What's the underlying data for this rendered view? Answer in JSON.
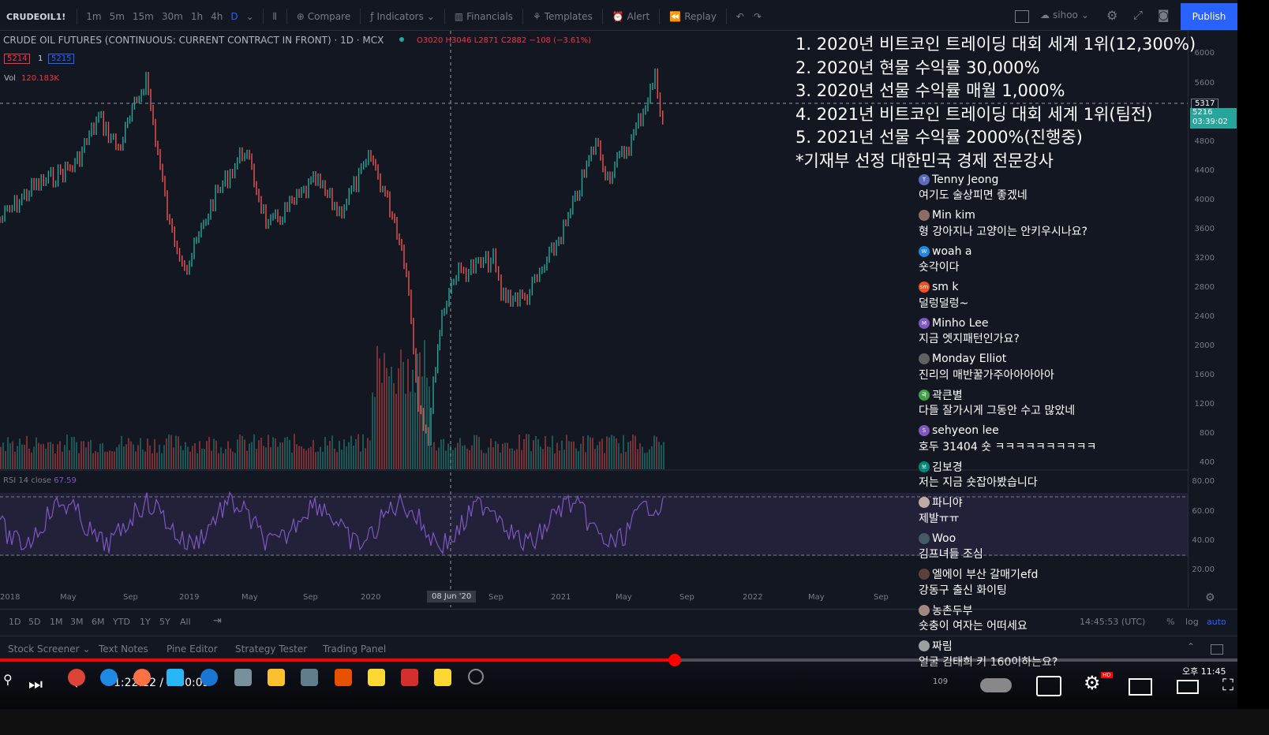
{
  "toolbar": {
    "symbol": "CRUDEOIL1!",
    "timeframes": [
      "1m",
      "5m",
      "15m",
      "30m",
      "1h",
      "4h",
      "D"
    ],
    "active_timeframe": "D",
    "compare": "Compare",
    "indicators": "Indicators",
    "financials": "Financials",
    "templates": "Templates",
    "alert": "Alert",
    "replay": "Replay",
    "user": "sihoo",
    "publish": "Publish"
  },
  "legend": {
    "title": "CRUDE OIL FUTURES (CONTINUOUS: CURRENT CONTRACT IN FRONT) · 1D · MCX",
    "ohlc": "O3020 H3046 L2871 C2882 −108 (−3.61%)",
    "bid": "5214",
    "spread": "1",
    "ask": "5215",
    "vol_label": "Vol",
    "vol_value": "120.183K",
    "rsi_label": "RSI 14 close",
    "rsi_value": "67.59"
  },
  "price_axis": {
    "ticks": [
      "6000",
      "5600",
      "4800",
      "4400",
      "4000",
      "3600",
      "3200",
      "2800",
      "2400",
      "2000",
      "1600",
      "1200",
      "800",
      "400"
    ],
    "rsi_ticks": [
      "80.00",
      "60.00",
      "40.00",
      "20.00"
    ],
    "last_price": "5317",
    "last_price2": "5216",
    "countdown": "03:39:02"
  },
  "time_axis": {
    "ticks": [
      "2018",
      "May",
      "Sep",
      "2019",
      "May",
      "Sep",
      "2020",
      "Sep",
      "2021",
      "May",
      "Sep",
      "2022",
      "May",
      "Sep"
    ],
    "crosshair_label": "08 Jun '20"
  },
  "bottom_bar": {
    "ranges": [
      "1D",
      "5D",
      "1M",
      "3M",
      "6M",
      "YTD",
      "1Y",
      "5Y",
      "All"
    ],
    "clock": "14:45:53 (UTC)",
    "percent": "%",
    "log": "log",
    "auto": "auto"
  },
  "panel_tabs": [
    "Stock Screener",
    "Text Notes",
    "Pine Editor",
    "Strategy Tester",
    "Trading Panel"
  ],
  "overlay_lines": [
    "1. 2020년 비트코인 트레이딩 대회 세계 1위(12,300%)",
    "2. 2020년 현물 수익률 30,000%",
    "3. 2020년 선물 수익률 매월 1,000%",
    "4. 2021년 비트코인 트레이딩 대회 세계 1위(팀전)",
    "5. 2021년 선물 수익률 2000%(진행중)",
    "*기재부 선정 대한민국 경제 전문강사"
  ],
  "chat": [
    {
      "author": "Tenny Jeong",
      "text": "여기도 술상피면 좋겠네",
      "avatar": "#5c6bc0",
      "initial": "T"
    },
    {
      "author": "Min kim",
      "text": "형 강아지나 고양이는 안키우시나요?",
      "avatar": "#8d6e63",
      "initial": ""
    },
    {
      "author": "woah a",
      "text": "숏각이다",
      "avatar": "#1e88e5",
      "initial": "W"
    },
    {
      "author": "sm k",
      "text": "덜렁덜렁~",
      "avatar": "#f4511e",
      "initial": "sm"
    },
    {
      "author": "Minho Lee",
      "text": "지금 엣지패턴인가요?",
      "avatar": "#7e57c2",
      "initial": "M"
    },
    {
      "author": "Monday Elliot",
      "text": "진리의 매반꿀가주아아아아아",
      "avatar": "#616161",
      "initial": ""
    },
    {
      "author": "곽큰별",
      "text": "다들 잘가시게 그동안 수고 많았네",
      "avatar": "#43a047",
      "initial": "곽"
    },
    {
      "author": "sehyeon lee",
      "text": "호두 31404 숏 ㅋㅋㅋㅋㅋㅋㅋㅋㅋㅋ",
      "avatar": "#7e57c2",
      "initial": "S"
    },
    {
      "author": "김보경",
      "text": "저는 지금 숏잡아봤습니다",
      "avatar": "#00897b",
      "initial": "보"
    },
    {
      "author": "파니야",
      "text": "제발ㅠㅠ",
      "avatar": "#bcaaa4",
      "initial": ""
    },
    {
      "author": "Woo",
      "text": "김프녀들 조심",
      "avatar": "#455a64",
      "initial": ""
    },
    {
      "author": "엘에이 부산 갈매기efd",
      "text": "강동구 출신 화이팅",
      "avatar": "#5d4037",
      "initial": ""
    },
    {
      "author": "농촌두부",
      "text": "숏충이 여자는 어떠세요",
      "avatar": "#a1887f",
      "initial": ""
    },
    {
      "author": "짜림",
      "text": "얼굴 김태희 키 160이하는요?",
      "avatar": "#9e9e9e",
      "initial": ""
    }
  ],
  "player": {
    "time": "1:22:12 / 2:30:05",
    "progress": 0.545,
    "viewers": "109",
    "clock_time": "오후 11:45"
  }
}
